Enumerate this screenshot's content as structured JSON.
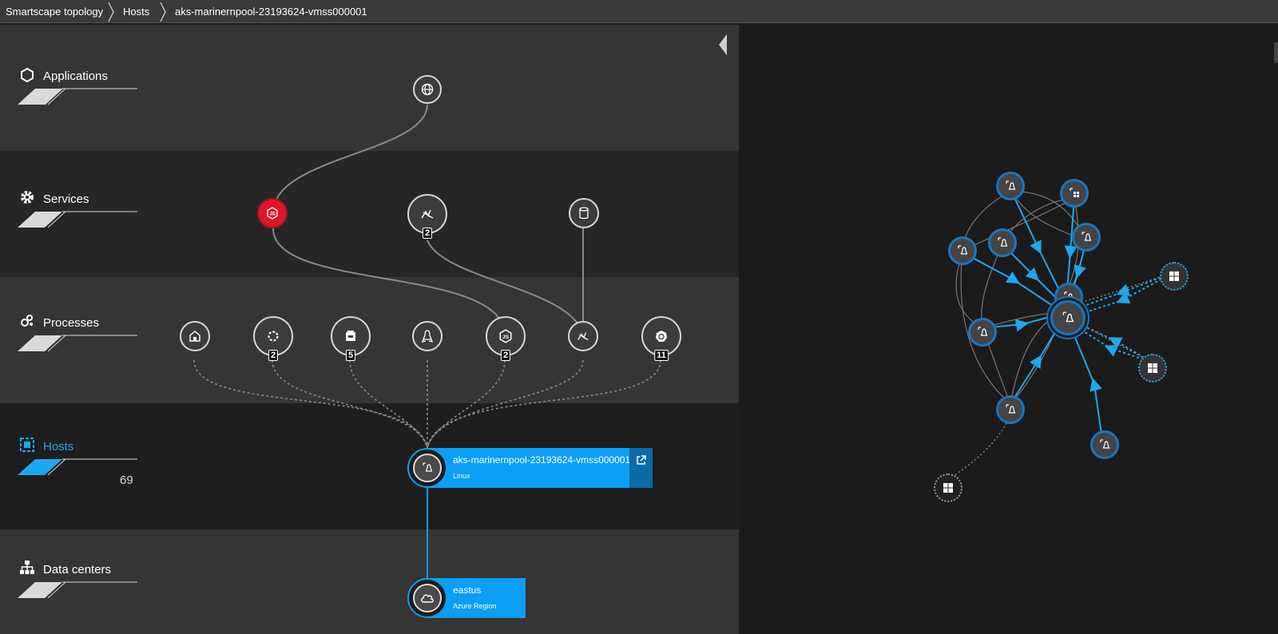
{
  "breadcrumb": [
    {
      "label": "Smartscape topology"
    },
    {
      "label": "Hosts"
    },
    {
      "label": "aks-marinernpool-23193624-vmss000001"
    }
  ],
  "layers": {
    "applications": {
      "label": "Applications"
    },
    "services": {
      "label": "Services"
    },
    "processes": {
      "label": "Processes"
    },
    "hosts": {
      "label": "Hosts",
      "count": "69"
    },
    "datacenters": {
      "label": "Data centers"
    }
  },
  "applications": [
    {
      "icon": "globe-icon"
    }
  ],
  "services": [
    {
      "icon": "nodejs-icon",
      "status": "problem"
    },
    {
      "icon": "network-service-icon",
      "count": "2"
    },
    {
      "icon": "database-icon"
    }
  ],
  "processes": [
    {
      "icon": "web-server-icon"
    },
    {
      "icon": "cluster-process-icon",
      "count": "2"
    },
    {
      "icon": "container-process-icon",
      "count": "5"
    },
    {
      "icon": "linux-icon"
    },
    {
      "icon": "nodejs-icon",
      "count": "2"
    },
    {
      "icon": "network-process-icon"
    },
    {
      "icon": "kubernetes-icon",
      "count": "11"
    }
  ],
  "host": {
    "name": "aks-marinernpool-23193624-vmss000001",
    "os": "Linux"
  },
  "datacenter": {
    "name": "eastus",
    "type": "Azure Region"
  },
  "colors": {
    "accent": "#0b9ef5",
    "problem": "#dc172a",
    "band_light": "#353535",
    "band_dark": "#262626"
  }
}
